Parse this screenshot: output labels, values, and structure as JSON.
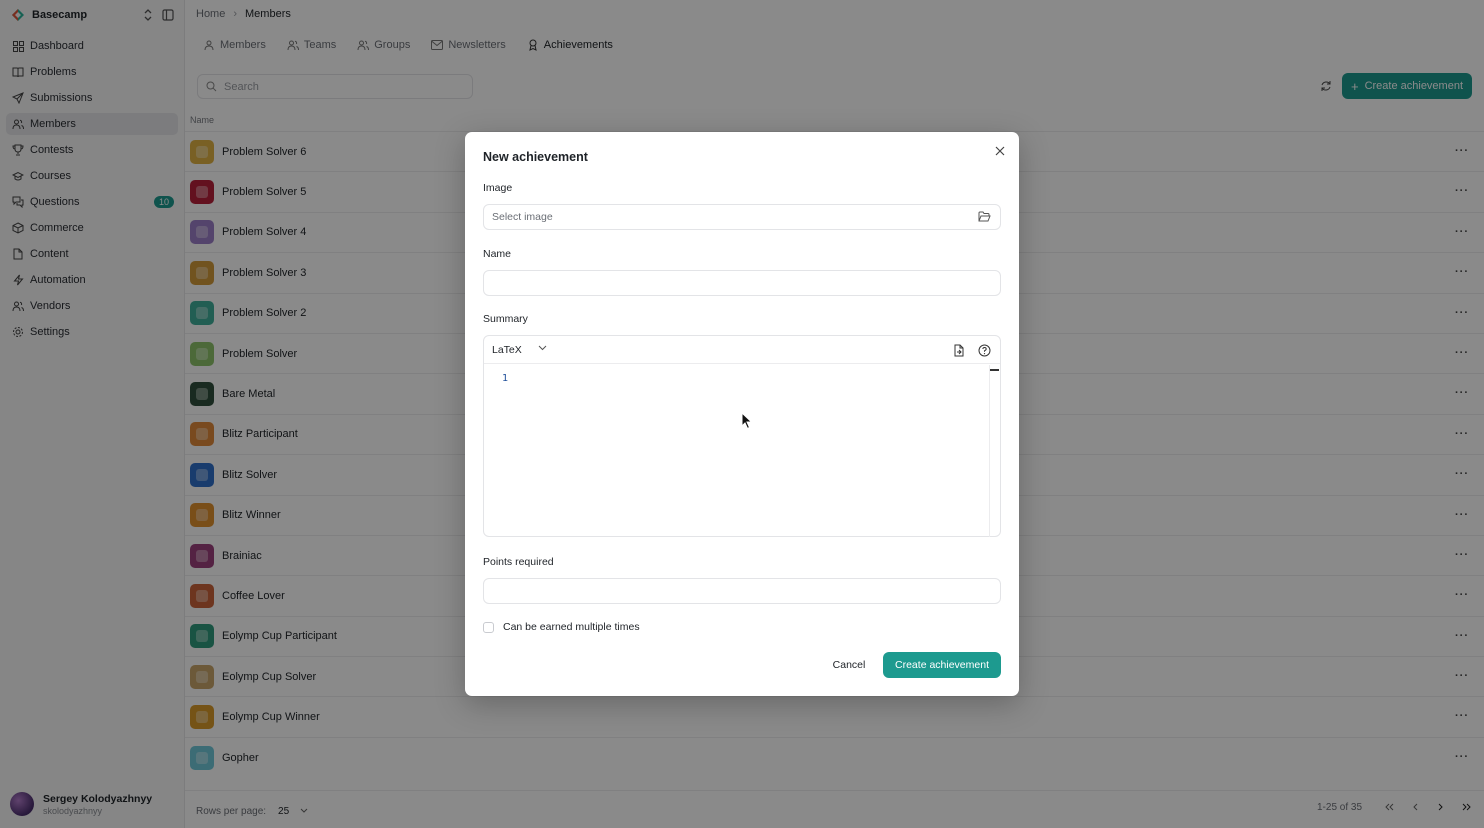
{
  "app": {
    "workspace_name": "Basecamp"
  },
  "sidebar": {
    "items": [
      {
        "label": "Dashboard",
        "icon": "dashboard-icon"
      },
      {
        "label": "Problems",
        "icon": "book-icon"
      },
      {
        "label": "Submissions",
        "icon": "send-icon"
      },
      {
        "label": "Members",
        "icon": "users-icon",
        "active": true
      },
      {
        "label": "Contests",
        "icon": "trophy-icon"
      },
      {
        "label": "Courses",
        "icon": "graduation-cap-icon"
      },
      {
        "label": "Questions",
        "icon": "messages-icon",
        "badge": "10"
      },
      {
        "label": "Commerce",
        "icon": "package-icon"
      },
      {
        "label": "Content",
        "icon": "file-icon"
      },
      {
        "label": "Automation",
        "icon": "zap-icon"
      },
      {
        "label": "Vendors",
        "icon": "users-icon"
      },
      {
        "label": "Settings",
        "icon": "gear-icon"
      }
    ],
    "user": {
      "name": "Sergey Kolodyazhnyy",
      "handle": "skolodyazhnyy"
    }
  },
  "breadcrumb": {
    "home": "Home",
    "current": "Members"
  },
  "tabs": [
    {
      "label": "Members",
      "icon": "user-icon"
    },
    {
      "label": "Teams",
      "icon": "users-icon"
    },
    {
      "label": "Groups",
      "icon": "users-icon"
    },
    {
      "label": "Newsletters",
      "icon": "mail-icon"
    },
    {
      "label": "Achievements",
      "icon": "award-icon",
      "active": true
    }
  ],
  "toolbar": {
    "search_placeholder": "Search",
    "create_label": "Create achievement"
  },
  "table": {
    "column_name": "Name",
    "rows": [
      {
        "name": "Problem Solver 6",
        "color": "#e0b243"
      },
      {
        "name": "Problem Solver 5",
        "color": "#b8203a"
      },
      {
        "name": "Problem Solver 4",
        "color": "#9b7fc7"
      },
      {
        "name": "Problem Solver 3",
        "color": "#d19a3a"
      },
      {
        "name": "Problem Solver 2",
        "color": "#3fae9a"
      },
      {
        "name": "Problem Solver",
        "color": "#8cc36a"
      },
      {
        "name": "Bare Metal",
        "color": "#2f4f3b"
      },
      {
        "name": "Blitz Participant",
        "color": "#e08a3a"
      },
      {
        "name": "Blitz Solver",
        "color": "#2f6fc9"
      },
      {
        "name": "Blitz Winner",
        "color": "#e0902e"
      },
      {
        "name": "Brainiac",
        "color": "#9c3f7c"
      },
      {
        "name": "Coffee Lover",
        "color": "#c9633a"
      },
      {
        "name": "Eolymp Cup Participant",
        "color": "#2f9a7c"
      },
      {
        "name": "Eolymp Cup Solver",
        "color": "#c7a56a"
      },
      {
        "name": "Eolymp Cup Winner",
        "color": "#d89a2a"
      },
      {
        "name": "Gopher",
        "color": "#6fc7d9"
      }
    ]
  },
  "footer": {
    "rows_per_page_label": "Rows per page:",
    "rows_per_page_value": "25",
    "page_info": "1-25 of 35"
  },
  "dialog": {
    "title": "New achievement",
    "image_label": "Image",
    "image_placeholder": "Select image",
    "name_label": "Name",
    "summary_label": "Summary",
    "summary_format": "LaTeX",
    "editor_line_number": "1",
    "points_label": "Points required",
    "multiple_label": "Can be earned multiple times",
    "cancel_label": "Cancel",
    "create_label": "Create achievement"
  },
  "colors": {
    "accent": "#1d9a8f"
  }
}
